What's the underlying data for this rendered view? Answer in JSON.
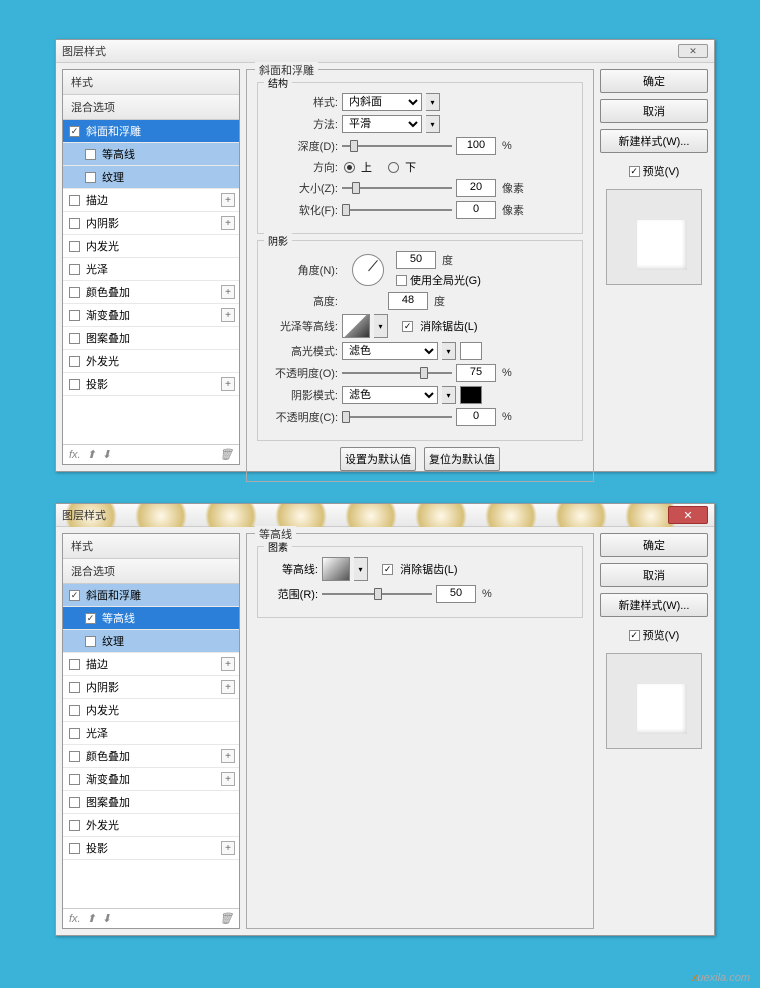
{
  "dialog_title": "图层样式",
  "sidebar": {
    "styles_header": "样式",
    "blend_header": "混合选项",
    "items": [
      {
        "label": "斜面和浮雕",
        "checked": true
      },
      {
        "label": "等高线",
        "checked": false
      },
      {
        "label": "纹理",
        "checked": false
      },
      {
        "label": "描边",
        "checked": false
      },
      {
        "label": "内阴影",
        "checked": false
      },
      {
        "label": "内发光",
        "checked": false
      },
      {
        "label": "光泽",
        "checked": false
      },
      {
        "label": "颜色叠加",
        "checked": false
      },
      {
        "label": "渐变叠加",
        "checked": false
      },
      {
        "label": "图案叠加",
        "checked": false
      },
      {
        "label": "外发光",
        "checked": false
      },
      {
        "label": "投影",
        "checked": false
      }
    ],
    "fx_label": "fx."
  },
  "panel1": {
    "title": "斜面和浮雕",
    "structure": {
      "legend": "结构",
      "style_lbl": "样式:",
      "style_val": "内斜面",
      "method_lbl": "方法:",
      "method_val": "平滑",
      "depth_lbl": "深度(D):",
      "depth_val": "100",
      "pct": "%",
      "dir_lbl": "方向:",
      "up": "上",
      "down": "下",
      "size_lbl": "大小(Z):",
      "size_val": "20",
      "px": "像素",
      "soften_lbl": "软化(F):",
      "soften_val": "0"
    },
    "shading": {
      "legend": "阴影",
      "angle_lbl": "角度(N):",
      "angle_val": "50",
      "deg": "度",
      "global_lbl": "使用全局光(G)",
      "alt_lbl": "高度:",
      "alt_val": "48",
      "gloss_lbl": "光泽等高线:",
      "antialias_lbl": "消除锯齿(L)",
      "hl_mode_lbl": "高光模式:",
      "hl_mode_val": "滤色",
      "hl_op_lbl": "不透明度(O):",
      "hl_op_val": "75",
      "sh_mode_lbl": "阴影模式:",
      "sh_mode_val": "滤色",
      "sh_op_lbl": "不透明度(C):",
      "sh_op_val": "0"
    },
    "default_btn": "设置为默认值",
    "reset_btn": "复位为默认值"
  },
  "panel2": {
    "title": "等高线",
    "elements_legend": "图素",
    "contour_lbl": "等高线:",
    "antialias_lbl": "消除锯齿(L)",
    "range_lbl": "范围(R):",
    "range_val": "50",
    "pct": "%"
  },
  "right": {
    "ok": "确定",
    "cancel": "取消",
    "newstyle": "新建样式(W)...",
    "preview": "预览(V)"
  },
  "watermark": {
    "x": "x",
    "rest": "uexila.com"
  }
}
